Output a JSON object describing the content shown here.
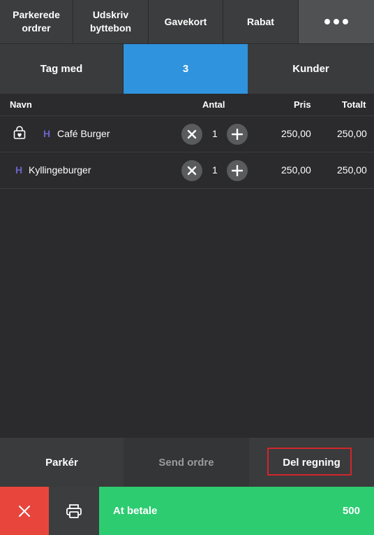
{
  "topbar": {
    "parked_orders": "Parkerede\nordrer",
    "print_exchange": "Udskriv\nbyttebon",
    "gift_card": "Gavekort",
    "discount": "Rabat"
  },
  "tabs": {
    "takeaway": "Tag med",
    "count": "3",
    "customers": "Kunder"
  },
  "table": {
    "headers": {
      "name": "Navn",
      "qty": "Antal",
      "price": "Pris",
      "total": "Totalt"
    },
    "rows": [
      {
        "marker": "H",
        "name": "Café Burger",
        "qty": "1",
        "price": "250,00",
        "total": "250,00",
        "takeaway_icon": "bag-heart-icon"
      },
      {
        "marker": "H",
        "name": "Kyllingeburger",
        "qty": "1",
        "price": "250,00",
        "total": "250,00"
      }
    ]
  },
  "actions": {
    "park": "Parkér",
    "send_order": "Send ordre",
    "split_bill": "Del regning"
  },
  "paybar": {
    "label": "At betale",
    "amount": "500"
  },
  "colors": {
    "accent_blue": "#2f93dd",
    "pay_green": "#2ecc71",
    "cancel_red": "#e8463d",
    "highlight_red": "#d0262b",
    "marker_purple": "#6b64c6"
  }
}
